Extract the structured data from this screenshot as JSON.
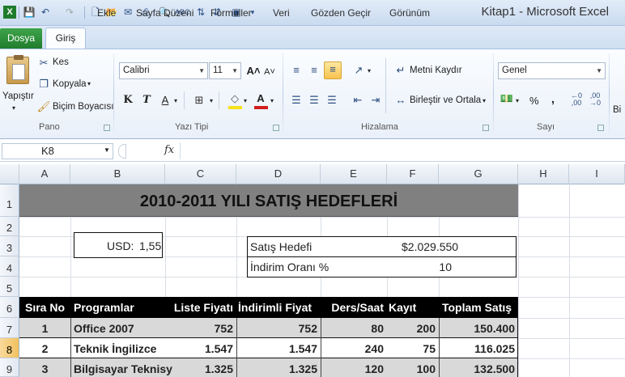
{
  "window": {
    "title": "Kitap1 - Microsoft Excel"
  },
  "tabs": {
    "file": "Dosya",
    "items": [
      "Giriş",
      "Ekle",
      "Sayfa Düzeni",
      "Formüller",
      "Veri",
      "Gözden Geçir",
      "Görünüm"
    ]
  },
  "ribbon": {
    "clipboard": {
      "paste": "Yapıştır",
      "cut": "Kes",
      "copy": "Kopyala",
      "format_painter": "Biçim Boyacısı",
      "label": "Pano"
    },
    "font": {
      "name": "Calibri",
      "size": "11",
      "bold": "K",
      "italic": "T",
      "underline": "A",
      "label": "Yazı Tipi"
    },
    "alignment": {
      "wrap": "Metni Kaydır",
      "merge": "Birleştir ve Ortala",
      "label": "Hizalama"
    },
    "number": {
      "format": "Genel",
      "percent": "%",
      "comma": ",",
      "label": "Sayı"
    },
    "styles": {
      "label": "Bi"
    }
  },
  "formula_bar": {
    "name_box": "K8",
    "fx": "fx",
    "content": ""
  },
  "columns": [
    "A",
    "B",
    "C",
    "D",
    "E",
    "F",
    "G",
    "H",
    "I"
  ],
  "rows": [
    "1",
    "2",
    "3",
    "4",
    "5",
    "6",
    "7",
    "8",
    "9"
  ],
  "active_row": "8",
  "sheet": {
    "title": "2010-2011 YILI SATIŞ HEDEFLERİ",
    "usd_label": "USD:",
    "usd_value": "1,55",
    "target_label": "Satış Hedefi",
    "target_value": "$2.029.550",
    "discount_label": "İndirim Oranı %",
    "discount_value": "10",
    "headers": [
      "Sıra No",
      "Programlar",
      "Liste Fiyatı",
      "İndirimli Fiyat",
      "Ders/Saat",
      "Kayıt",
      "Toplam Satış"
    ],
    "data_rows": [
      [
        "1",
        "Office 2007",
        "752",
        "752",
        "80",
        "200",
        "150.400"
      ],
      [
        "2",
        "Teknik İngilizce",
        "1.547",
        "1.547",
        "240",
        "75",
        "116.025"
      ],
      [
        "3",
        "Bilgisayar Teknisy",
        "1.325",
        "1.325",
        "120",
        "100",
        "132.500"
      ]
    ]
  }
}
